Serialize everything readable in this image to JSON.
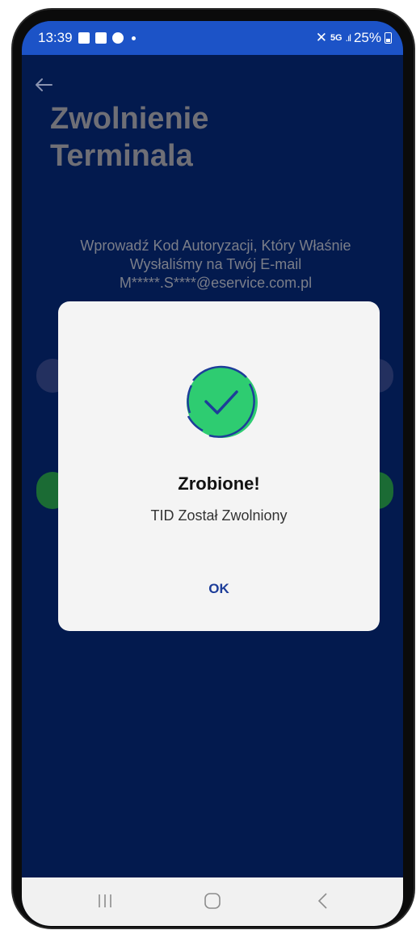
{
  "status_bar": {
    "time": "13:39",
    "network_badge": "5G",
    "battery_percent": "25%"
  },
  "page": {
    "back_icon": "arrow-left-icon",
    "title_line1": "Zwolnienie",
    "title_line2": "Terminala",
    "instruction_line1": "Wprowadź Kod Autoryzacji, Który Właśnie",
    "instruction_line2": "Wysłaliśmy na Twój E-mail",
    "email_masked": "M*****.S****@eservice.com.pl"
  },
  "dialog": {
    "icon": "success-check-icon",
    "accent_color": "#2ecc71",
    "ring_color": "#1d3d99",
    "title": "Zrobione!",
    "message": "TID Został Zwolniony",
    "ok_label": "OK"
  },
  "nav_bar": {
    "recents_icon": "recents-icon",
    "home_icon": "home-icon",
    "back_icon": "back-icon"
  }
}
